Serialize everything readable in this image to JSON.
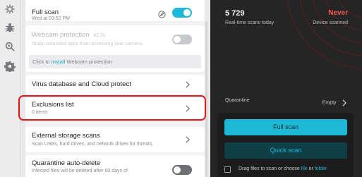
{
  "colors": {
    "accent": "#1db8d6",
    "highlight": "#e3141c",
    "danger_text": "#f2574f",
    "dark_bg": "#252525",
    "link": "#1ba5c9"
  },
  "sidebar": {
    "icons": [
      "virus-icon",
      "bug-icon",
      "search-scan-icon",
      "gear-icon"
    ]
  },
  "settings": {
    "full_scan": {
      "title": "Full scan",
      "subtitle": "Wed at 03:52 PM",
      "enabled": true
    },
    "webcam": {
      "title": "Webcam protection",
      "badge": "BETA",
      "description": "Stops untrusted apps from accessing your camera.",
      "note_prefix": "Click to",
      "note_link": "Install",
      "note_suffix": "Webcam protection",
      "enabled": false
    },
    "virus_db": {
      "title": "Virus database and Cloud protect"
    },
    "exclusions": {
      "title": "Exclusions list",
      "subtitle": "0 items"
    },
    "external": {
      "title": "External storage scans",
      "subtitle": "Scan USBs, hard drives, and network drives for threats."
    },
    "quarantine_auto": {
      "title": "Quarantine auto-delete",
      "subtitle": "Infected files will be deleted after 60 days of",
      "enabled": false
    }
  },
  "stats": {
    "scans_value": "5 729",
    "scans_label": "Real-time scans today",
    "last_scan_value": "Never",
    "last_scan_label": "Device scanned"
  },
  "quarantine": {
    "label": "Quarantine",
    "status": "Empty"
  },
  "actions": {
    "full_scan": "Full scan",
    "quick_scan": "Quick scan",
    "drop_prefix": "Drag files to scan or choose",
    "drop_file": "file",
    "drop_or": "or",
    "drop_folder": "folder"
  }
}
